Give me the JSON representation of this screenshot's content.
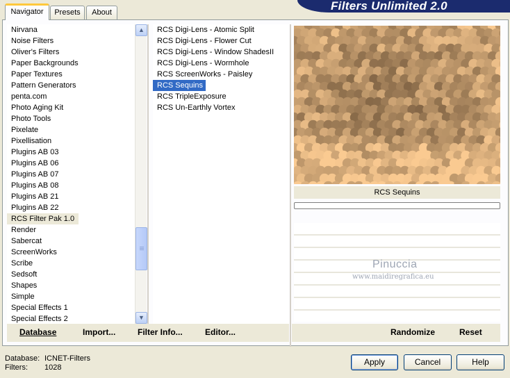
{
  "tabs": [
    "Navigator",
    "Presets",
    "About"
  ],
  "brand": "Filters Unlimited 2.0",
  "categories": [
    "Nirvana",
    "Noise Filters",
    "Oliver's Filters",
    "Paper Backgrounds",
    "Paper Textures",
    "Pattern Generators",
    "penta.com",
    "Photo Aging Kit",
    "Photo Tools",
    "Pixelate",
    "Pixellisation",
    "Plugins AB 03",
    "Plugins AB 06",
    "Plugins AB 07",
    "Plugins AB 08",
    "Plugins AB 21",
    "Plugins AB 22",
    "RCS Filter Pak 1.0",
    "Render",
    "Sabercat",
    "ScreenWorks",
    "Scribe",
    "Sedsoft",
    "Shapes",
    "Simple",
    "Special Effects 1",
    "Special Effects 2"
  ],
  "selected_category": "RCS Filter Pak 1.0",
  "filters": [
    "RCS Digi-Lens - Atomic Split",
    "RCS Digi-Lens - Flower Cut",
    "RCS Digi-Lens - Window ShadesII",
    "RCS Digi-Lens - Wormhole",
    "RCS ScreenWorks - Paisley",
    "RCS Sequins",
    "RCS TripleExposure",
    "RCS Un-Earthly Vortex"
  ],
  "selected_filter": "RCS Sequins",
  "left_buttons": {
    "database": "Database",
    "import": "Import...",
    "filter_info": "Filter Info...",
    "editor": "Editor..."
  },
  "right_buttons": {
    "randomize": "Randomize",
    "reset": "Reset"
  },
  "preview_title": "RCS Sequins",
  "progress": 0,
  "watermark": {
    "name": "Pinuccia",
    "url": "www.maidiregrafica.eu"
  },
  "footer": {
    "database_label": "Database:",
    "database_value": "ICNET-Filters",
    "filters_label": "Filters:",
    "filters_value": "1028"
  },
  "dialog_buttons": {
    "apply": "Apply",
    "cancel": "Cancel",
    "help": "Help"
  },
  "colors": {
    "brand_bg": "#1b2b6e",
    "selection": "#316ac5",
    "tab_highlight": "#ffc83c"
  }
}
